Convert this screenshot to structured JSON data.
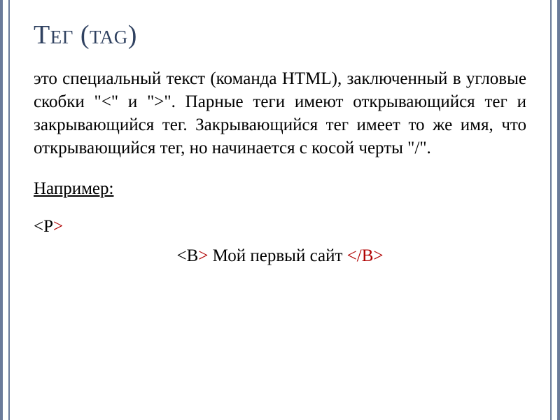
{
  "title": "Тег (tag)",
  "description": "это специальный текст (команда HTML), заключенный в угловые скобки \"<\" и \">\". Парные теги имеют открывающийся тег и закрывающийся тег. Закрывающийся тег имеет то же имя, что открывающийся тег, но начинается с косой черты \"/\".",
  "example_label": "Например:",
  "example": {
    "open_p_lt": "<",
    "open_p_name": "P",
    "open_p_gt": ">",
    "open_b_lt": "<",
    "open_b_name": "B",
    "open_b_gt": ">",
    "content": " Мой первый сайт ",
    "close_b_lt": "<",
    "close_b_slash_name": "/B",
    "close_b_gt": ">"
  }
}
